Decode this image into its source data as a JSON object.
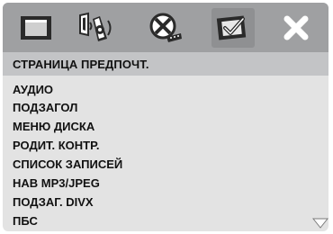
{
  "tabs": [
    {
      "name": "general-setup",
      "icon": "screen-icon"
    },
    {
      "name": "audio-setup",
      "icon": "speaker-icon"
    },
    {
      "name": "video-setup",
      "icon": "film-reel-icon"
    },
    {
      "name": "preferences",
      "icon": "checked-screen-icon",
      "selected": true
    },
    {
      "name": "exit",
      "icon": "close-icon"
    }
  ],
  "header": {
    "title": "СТРАНИЦА ПРЕДПОЧТ."
  },
  "menu": {
    "items": [
      "АУДИО",
      "ПОДЗАГОЛ",
      "МЕНЮ ДИСКА",
      "РОДИТ. КОНТР.",
      "СПИСОК ЗАПИСЕЙ",
      "НАВ MP3/JPEG",
      "ПОДЗАГ. DIVX",
      "ПБС"
    ]
  },
  "colors": {
    "icon_bar": "#9fa0a2",
    "header_bar": "#c3c4c6",
    "panel": "#e3e3e3",
    "icon_dark": "#2a2a2a",
    "icon_light": "#ffffff"
  }
}
